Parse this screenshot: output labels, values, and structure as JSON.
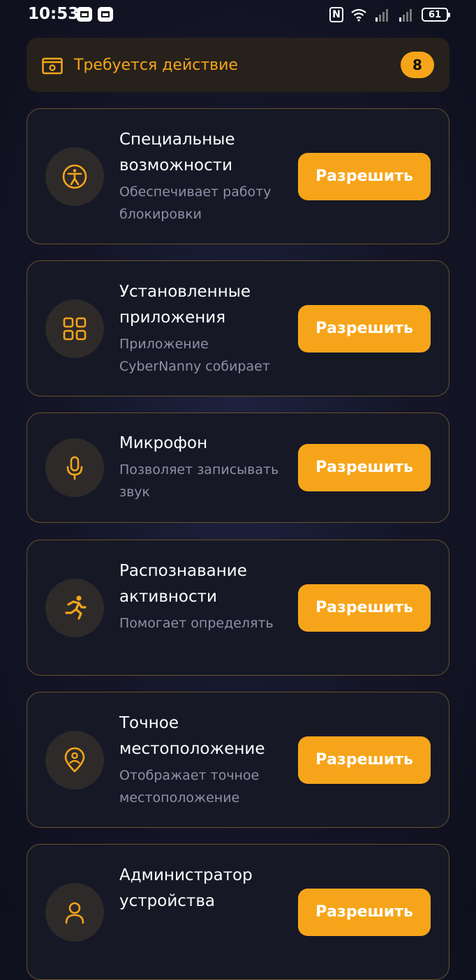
{
  "status_bar": {
    "time": "10:53",
    "battery": "61"
  },
  "action_required": {
    "label": "Требуется действие",
    "count": "8"
  },
  "colors": {
    "accent": "#f6a51a",
    "card_border": "#6a5128",
    "icon_circle": "#2e2a29",
    "muted_text": "#8e91a7"
  },
  "permissions": [
    {
      "title": "Специальные возможности",
      "description": "Обеспечивает работу блокировки",
      "icon": "accessibility-icon",
      "button": "Разрешить"
    },
    {
      "title": "Установленные приложения",
      "description": "Приложение CyberNanny собирает",
      "icon": "apps-grid-icon",
      "button": "Разрешить"
    },
    {
      "title": "Микрофон",
      "description": "Позволяет записывать звук",
      "icon": "microphone-icon",
      "button": "Разрешить"
    },
    {
      "title": "Распознавание активности",
      "description": "Помогает определять",
      "icon": "running-person-icon",
      "button": "Разрешить"
    },
    {
      "title": "Точное местоположение",
      "description": "Отображает точное местоположение",
      "icon": "location-person-icon",
      "button": "Разрешить"
    },
    {
      "title": "Администратор устройства",
      "description": "",
      "icon": "admin-icon",
      "button": "Разрешить"
    }
  ]
}
